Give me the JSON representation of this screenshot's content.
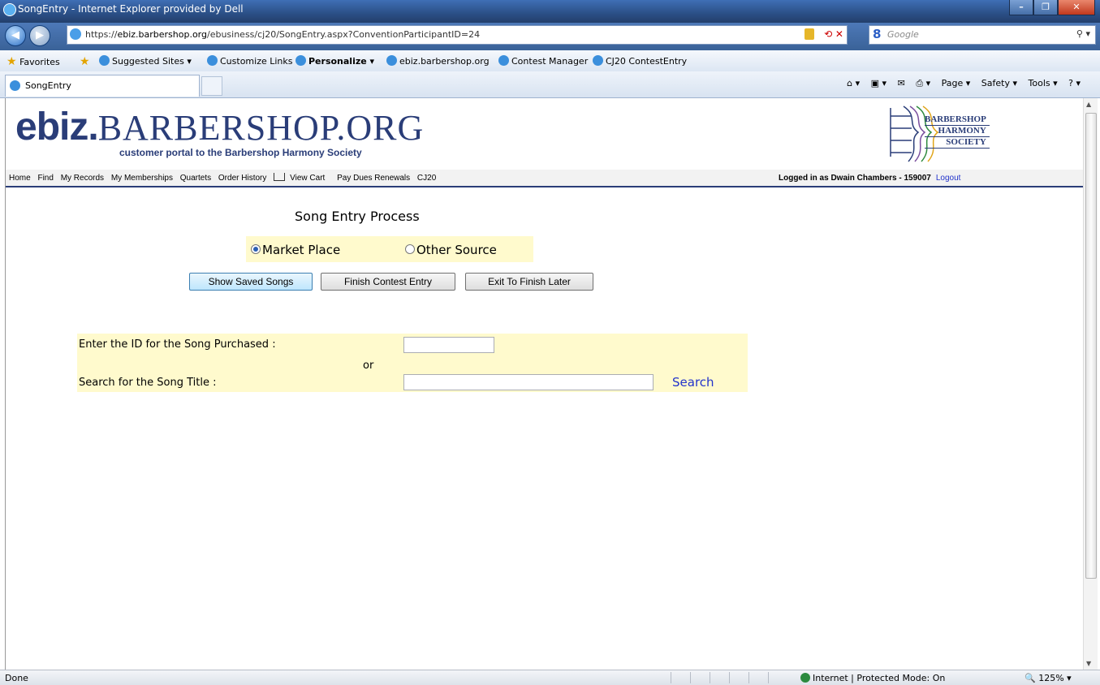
{
  "window": {
    "title": "SongEntry - Internet Explorer provided by Dell",
    "minimize": "–",
    "maximize": "❐",
    "close": "✕"
  },
  "address": {
    "url_prefix": "https://",
    "url_host": "ebiz.barbershop.org",
    "url_path": "/ebusiness/cj20/SongEntry.aspx?ConventionParticipantID=24",
    "search_placeholder": "Google",
    "search_logo": "8"
  },
  "favorites": {
    "label": "Favorites",
    "items": [
      "Suggested Sites ▾",
      "Customize Links",
      "Personalize ▾",
      "ebiz.barbershop.org",
      "Contest Manager",
      "CJ20 ContestEntry"
    ]
  },
  "tab": {
    "label": "SongEntry"
  },
  "commandbar": {
    "page": "Page ▾",
    "safety": "Safety ▾",
    "tools": "Tools ▾",
    "help": "? ▾"
  },
  "site": {
    "logo_ebiz": "ebiz.",
    "logo_barbershop": "BARBERSHOP.ORG",
    "tagline": "customer portal to the Barbershop Harmony Society",
    "bhs_lines": [
      "BARBERSHOP",
      "HARMONY",
      "SOCIETY"
    ]
  },
  "menu": {
    "items": [
      "Home",
      "Find",
      "My Records",
      "My Memberships",
      "Quartets",
      "Order History"
    ],
    "cart": "View Cart",
    "items2": [
      "Pay Dues Renewals",
      "CJ20"
    ],
    "login_text": "Logged in as Dwain Chambers - 159007",
    "logout": "Logout"
  },
  "form": {
    "heading": "Song Entry Process",
    "radio_market": "Market Place",
    "radio_other": "Other Source",
    "selected": "Market Place",
    "btn_show": "Show Saved Songs",
    "btn_finish": "Finish Contest Entry",
    "btn_exit": "Exit To Finish Later",
    "id_label": "Enter the ID for the Song Purchased :",
    "or": "or",
    "title_label": "Search for the Song Title :",
    "id_value": "",
    "title_value": "",
    "search_link": "Search"
  },
  "status": {
    "left": "Done",
    "zone": "Internet | Protected Mode: On",
    "zoom": "125%",
    "zoom_icon": "🔍"
  },
  "colors": {
    "brand": "#2a3d78",
    "highlight": "#fffacd",
    "link": "#2233cc"
  }
}
